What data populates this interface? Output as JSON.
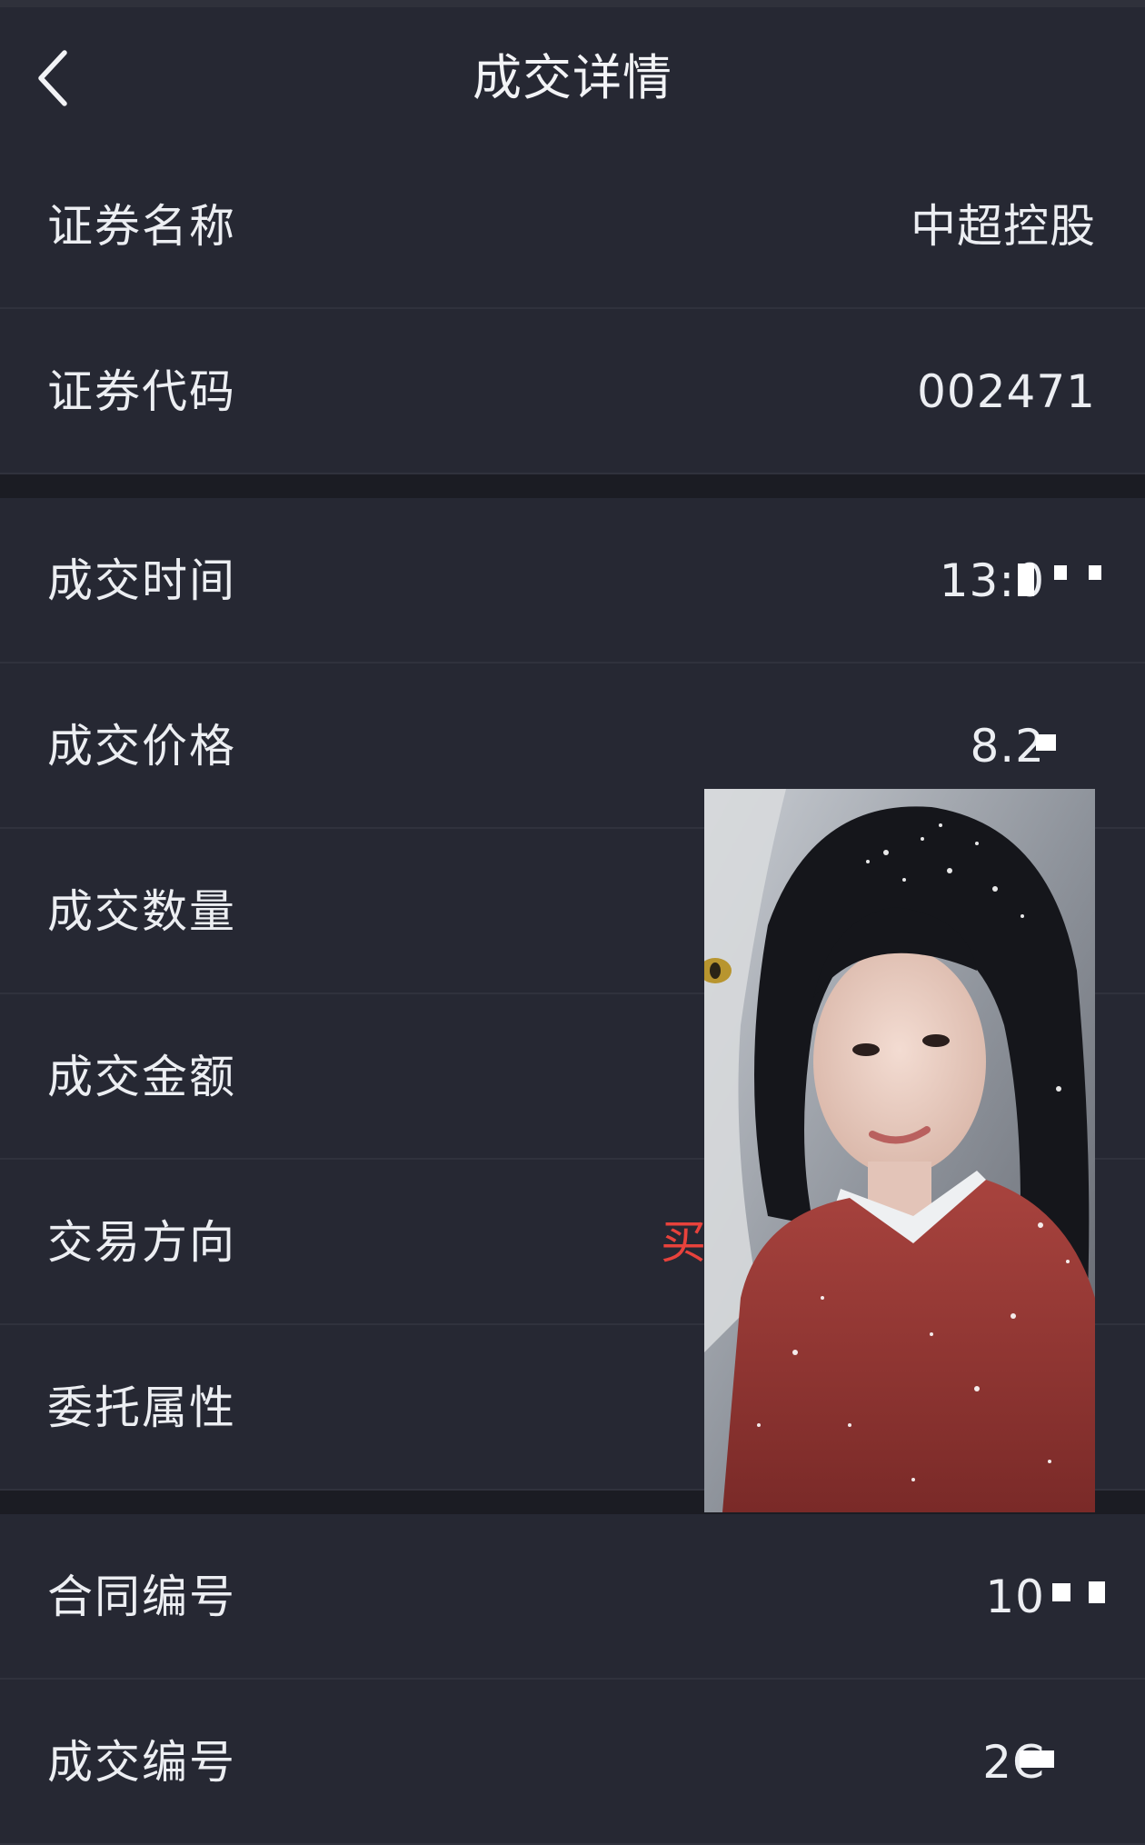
{
  "header": {
    "title": "成交详情",
    "back_icon": "chevron-left-icon"
  },
  "rows": [
    {
      "label": "证券名称",
      "value": "中超控股"
    },
    {
      "label": "证券代码",
      "value": "002471"
    },
    {
      "label": "成交时间",
      "value": "13:0"
    },
    {
      "label": "成交价格",
      "value": "8.2"
    },
    {
      "label": "成交数量",
      "value": ""
    },
    {
      "label": "成交金额",
      "value": ""
    },
    {
      "label": "交易方向",
      "value": "买"
    },
    {
      "label": "委托属性",
      "value": ""
    },
    {
      "label": "合同编号",
      "value": "10"
    },
    {
      "label": "成交编号",
      "value": "2C"
    }
  ],
  "colors": {
    "background": "#1b1c23",
    "row_background": "#262833",
    "divider": "#30323d",
    "text": "#eceef2",
    "buy_red": "#e8423c"
  },
  "overlay": {
    "subject": "portrait photo of a woman in red robe with snow"
  }
}
